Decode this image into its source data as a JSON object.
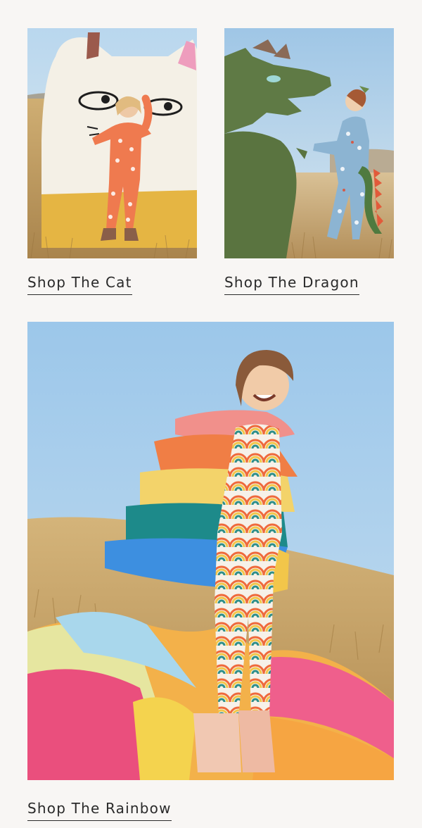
{
  "tiles": {
    "cat": {
      "link_label": "Shop The Cat",
      "image_alt": "Child in orange cat-print pajamas in front of a giant cat cutout"
    },
    "dragon": {
      "link_label": "Shop The Dragon",
      "image_alt": "Child in blue dragon-print pajamas beside a green dragon cutout"
    },
    "rainbow": {
      "link_label": "Shop The Rainbow",
      "image_alt": "Child in rainbow pajamas wearing a rainbow tulle cape"
    }
  },
  "colors": {
    "background": "#f8f6f4",
    "text": "#2a2a2a",
    "sky": "#a9cbe6",
    "grass": "#c7a46a"
  }
}
